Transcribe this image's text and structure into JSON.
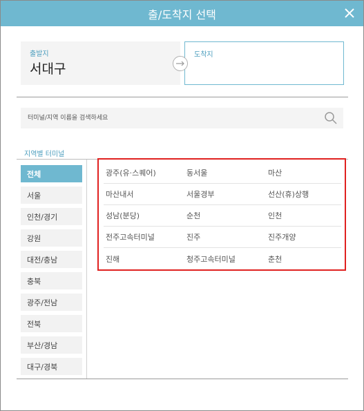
{
  "dialog": {
    "title": "출/도착지 선택"
  },
  "departure": {
    "label": "출발지",
    "value": "서대구"
  },
  "arrival": {
    "label": "도착지",
    "value": ""
  },
  "search": {
    "placeholder": "터미널/지역 이름을 검색하세요",
    "value": ""
  },
  "section": {
    "label": "지역별 터미널"
  },
  "regions": [
    {
      "label": "전체",
      "active": true
    },
    {
      "label": "서울",
      "active": false
    },
    {
      "label": "인천/경기",
      "active": false
    },
    {
      "label": "강원",
      "active": false
    },
    {
      "label": "대전/충남",
      "active": false
    },
    {
      "label": "충북",
      "active": false
    },
    {
      "label": "광주/전남",
      "active": false
    },
    {
      "label": "전북",
      "active": false
    },
    {
      "label": "부산/경남",
      "active": false
    },
    {
      "label": "대구/경북",
      "active": false
    }
  ],
  "terminals": [
    "광주(유·스퀘어)",
    "동서울",
    "마산",
    "마산내서",
    "서울경부",
    "선산(휴)상행",
    "성남(분당)",
    "순천",
    "인천",
    "전주고속터미널",
    "진주",
    "진주개양",
    "진해",
    "청주고속터미널",
    "춘천"
  ],
  "colors": {
    "accent": "#6fb8d0",
    "highlight_border": "#e0201f"
  },
  "icons": {
    "close": "close-icon",
    "swap": "swap-arrow-icon",
    "search": "search-icon"
  }
}
